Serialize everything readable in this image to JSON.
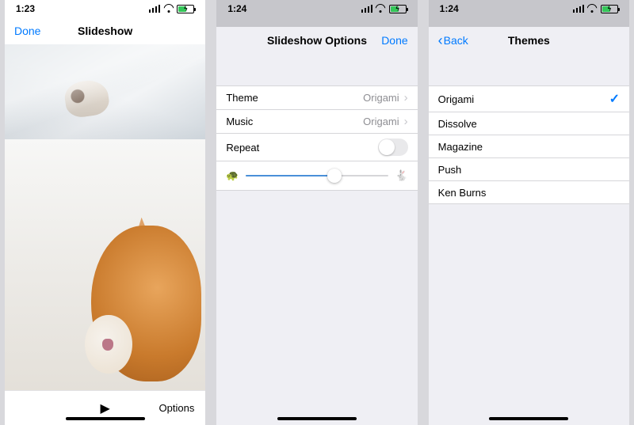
{
  "phone1": {
    "status_time": "1:23",
    "nav_left": "Done",
    "nav_title": "Slideshow",
    "toolbar_options": "Options"
  },
  "phone2": {
    "status_time": "1:24",
    "nav_title": "Slideshow Options",
    "nav_right": "Done",
    "rows": {
      "theme_label": "Theme",
      "theme_value": "Origami",
      "music_label": "Music",
      "music_value": "Origami",
      "repeat_label": "Repeat"
    },
    "slider_percent": 62
  },
  "phone3": {
    "status_time": "1:24",
    "nav_left": "Back",
    "nav_title": "Themes",
    "themes": [
      "Origami",
      "Dissolve",
      "Magazine",
      "Push",
      "Ken Burns"
    ],
    "selected_index": 0
  }
}
